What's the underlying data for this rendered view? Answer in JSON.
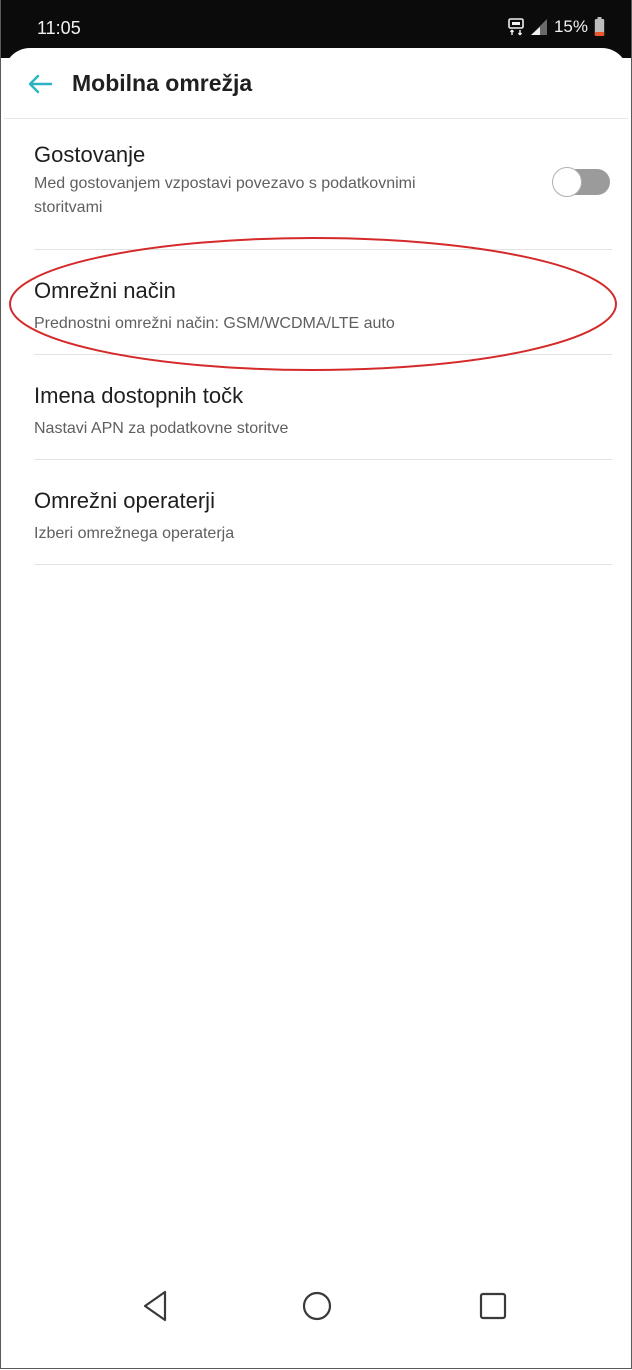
{
  "status_bar": {
    "time": "11:05",
    "battery_percent": "15%",
    "icons": [
      "data-icon",
      "signal-icon",
      "battery-low-icon"
    ]
  },
  "app_bar": {
    "back_icon": "arrow-left-icon",
    "title": "Mobilna omrežja"
  },
  "settings": [
    {
      "title": "Gostovanje",
      "subtitle": "Med gostovanjem vzpostavi povezavo s podatkovnimi storitvami",
      "toggle_on": false
    },
    {
      "title": "Omrežni način",
      "subtitle": "Prednostni omrežni način: GSM/WCDMA/LTE  auto"
    },
    {
      "title": "Imena dostopnih točk",
      "subtitle": "Nastavi APN za podatkovne storitve"
    },
    {
      "title": "Omrežni operaterji",
      "subtitle": "Izberi omrežnega operaterja"
    }
  ],
  "navigation": {
    "icons": [
      "nav-back-triangle-icon",
      "nav-home-circle-icon",
      "nav-recents-square-icon"
    ]
  },
  "colors": {
    "accent": "#2bb3c0",
    "annotation": "#d42a2a",
    "battery_low": "#e8562a",
    "toggle_off": "#9b9b9b"
  }
}
